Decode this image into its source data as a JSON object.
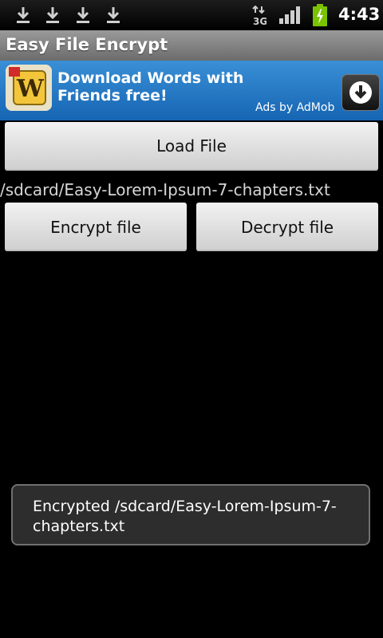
{
  "status_bar": {
    "notifications": [
      "download-icon",
      "download-icon",
      "download-icon",
      "download-icon"
    ],
    "network": "3G",
    "time": "4:43"
  },
  "title_bar": {
    "title": "Easy File Encrypt"
  },
  "ad": {
    "headline": "Download Words with Friends free!",
    "attribution": "Ads by AdMob",
    "logo_icon": "words-with-friends-icon",
    "action_icon": "download-circle-icon"
  },
  "main": {
    "load_button": "Load File",
    "file_path": "/sdcard/Easy-Lorem-Ipsum-7-chapters.txt",
    "encrypt_button": "Encrypt file",
    "decrypt_button": "Decrypt file"
  },
  "toast": {
    "message": "Encrypted /sdcard/Easy-Lorem-Ipsum-7-chapters.txt"
  },
  "colors": {
    "ad_background": "#1f76c8",
    "title_bar": "#888888",
    "battery": "#7ac300"
  }
}
